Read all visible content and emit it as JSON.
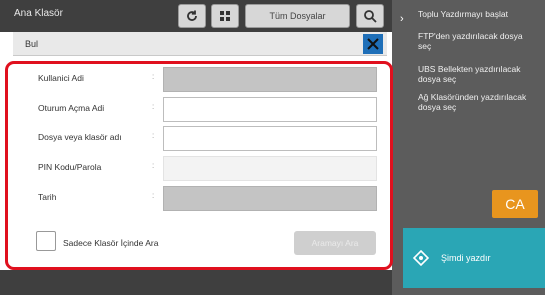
{
  "background": {
    "folder_title": "Ana Klasör",
    "all_files_label": "Tüm Dosyalar",
    "refresh_icon": "refresh-icon",
    "grid_icon": "grid-icon",
    "search_icon": "search-icon"
  },
  "sidebar": {
    "items": [
      {
        "label": "Toplu Yazdırmayı başlat"
      },
      {
        "label": "FTP'den yazdırılacak dosya seç"
      },
      {
        "label": "UBS Bellekten yazdırılacak dosya seç"
      },
      {
        "label": "Ağ Klasöründen yazdırılacak dosya seç"
      }
    ],
    "ca_label": "CA",
    "start_label": "Şimdi yazdır",
    "accent": "#e8951e",
    "start_color": "#2aa6b5"
  },
  "dialog": {
    "title": "Bul",
    "close_icon": "close-icon",
    "fields": [
      {
        "label": "Kullanici Adi",
        "value": "",
        "state": "disabled"
      },
      {
        "label": "Oturum Açma Adi",
        "value": "",
        "state": "enabled"
      },
      {
        "label": "Dosya veya klasör adı",
        "value": "",
        "state": "enabled"
      },
      {
        "label": "PIN Kodu/Parola",
        "value": "",
        "state": "flat"
      },
      {
        "label": "Tarih",
        "value": "",
        "state": "disabled"
      }
    ],
    "colon": ":",
    "checkbox_label": "Sadece Klasör İçinde Ara",
    "checkbox_checked": false,
    "search_button": "Aramayı Ara",
    "highlight_color": "#e0101e"
  }
}
